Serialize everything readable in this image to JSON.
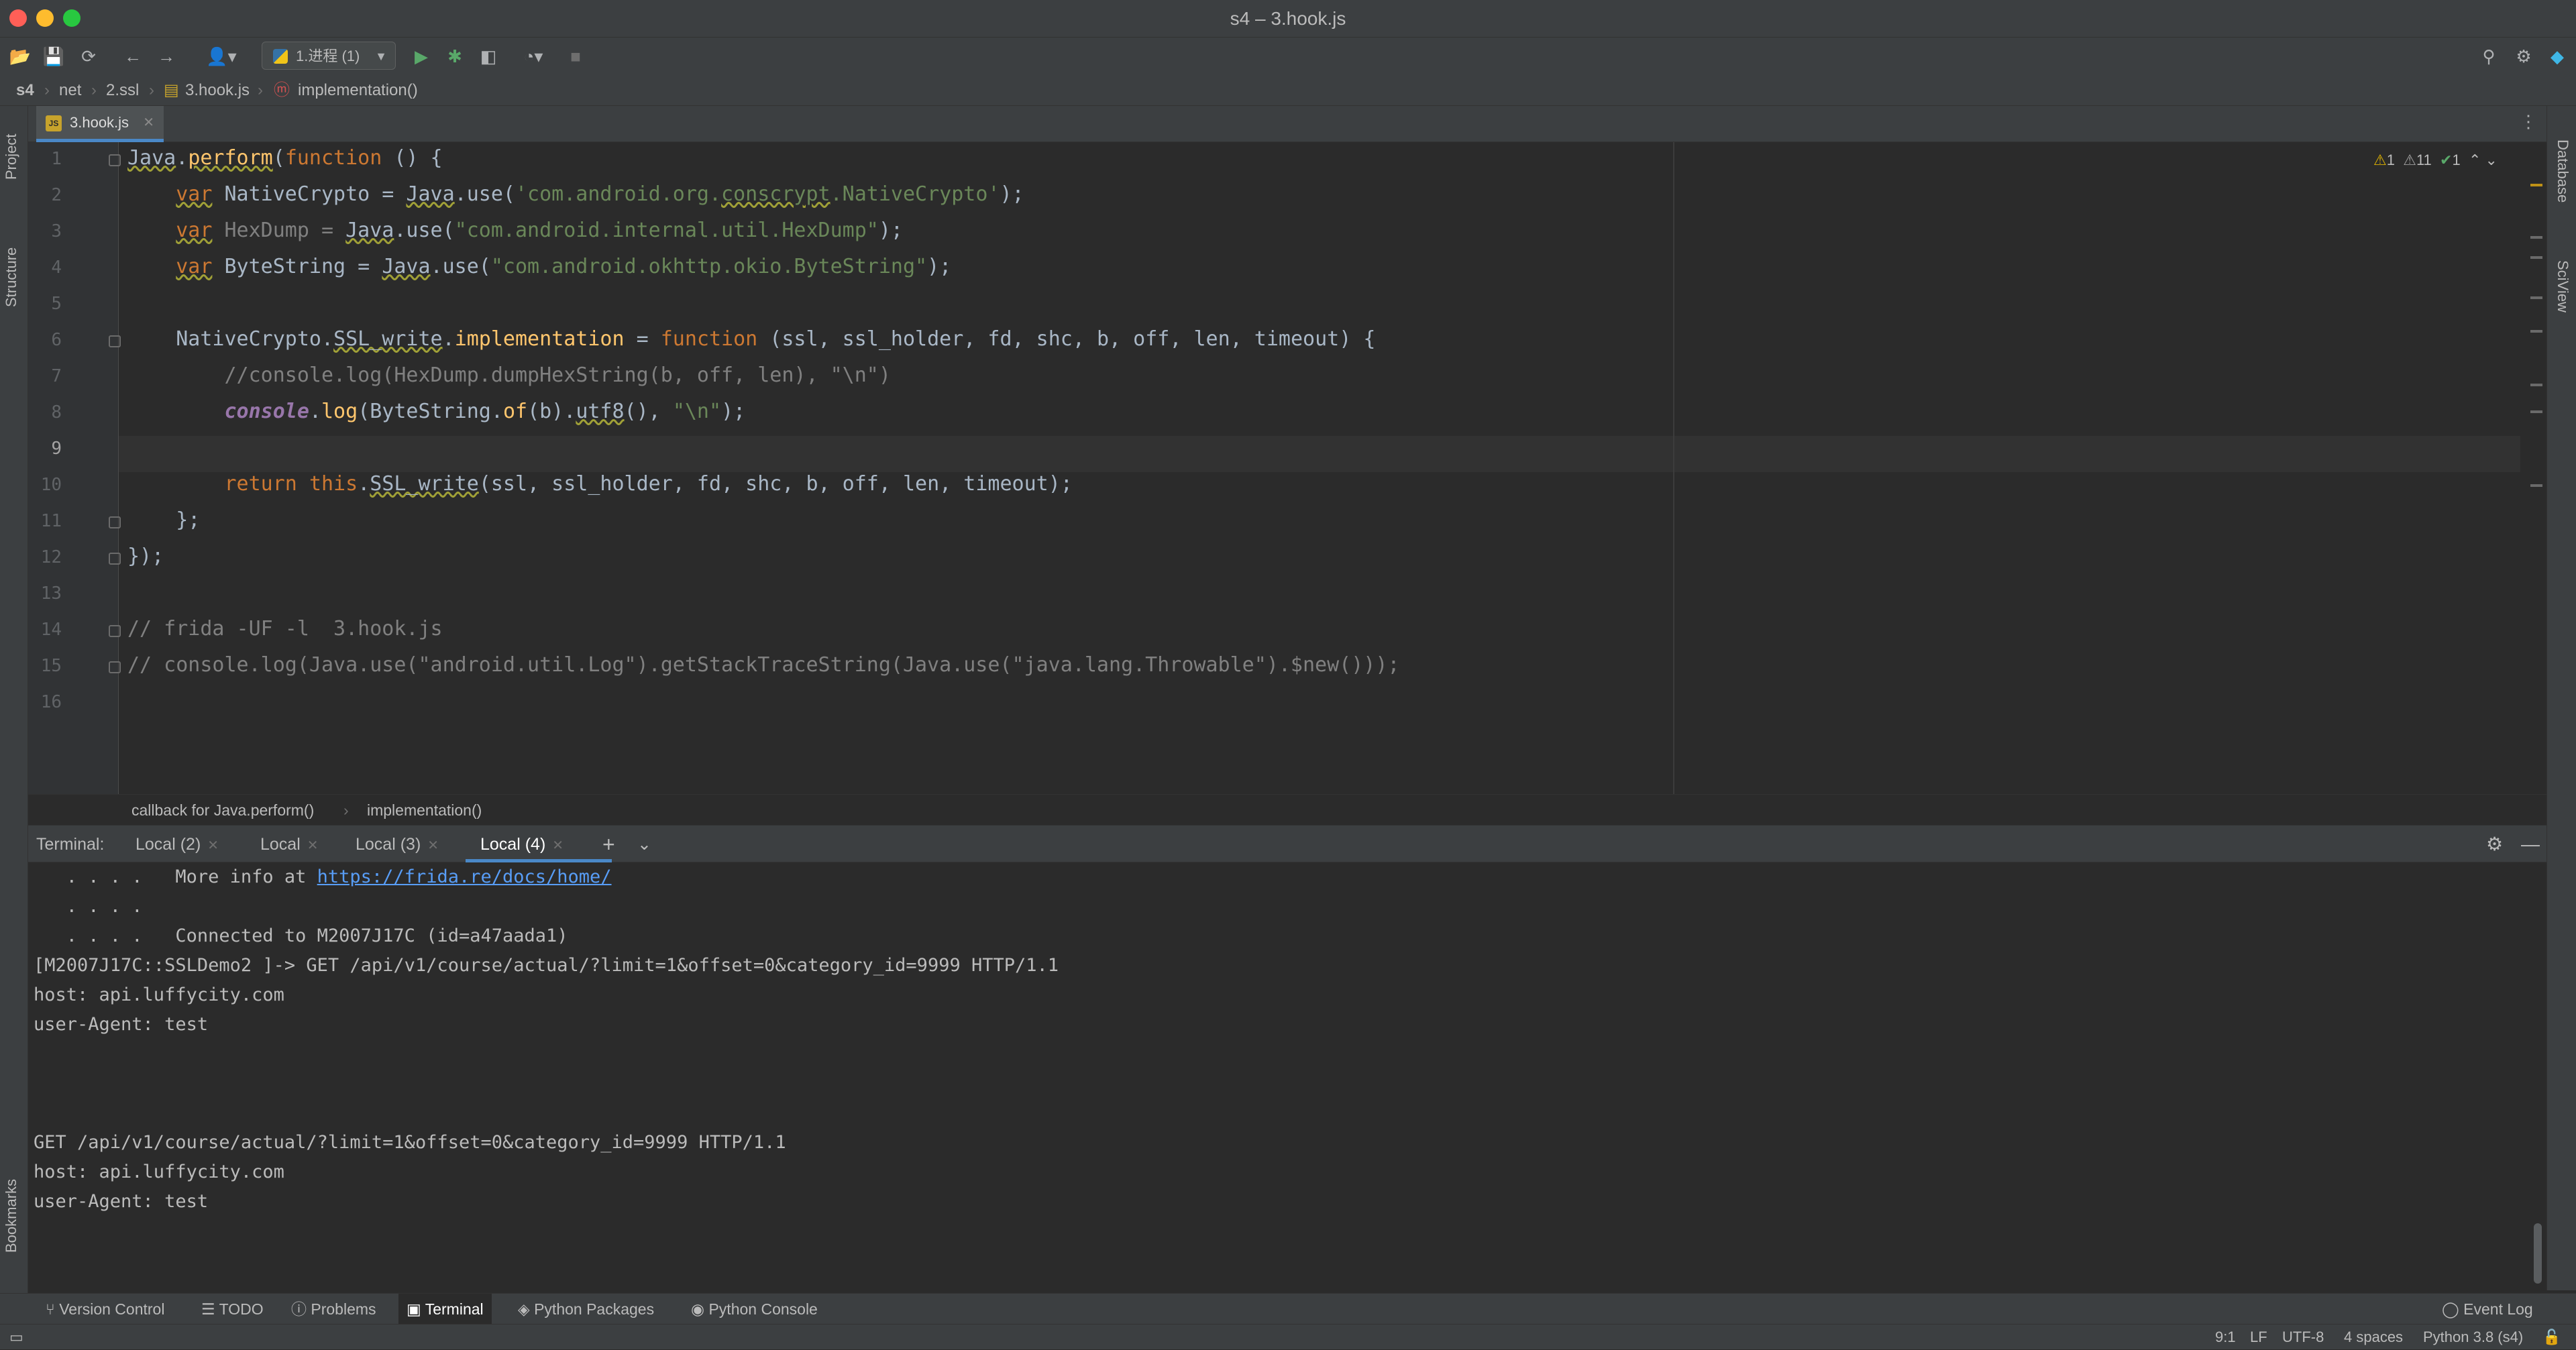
{
  "window": {
    "title": "s4 – 3.hook.js"
  },
  "toolbar": {
    "run_config": "1.进程 (1)",
    "icons": [
      "open-folder-icon",
      "save-icon",
      "sync-icon",
      "back-icon",
      "forward-icon",
      "user-icon",
      "run-icon",
      "debug-icon",
      "coverage-icon",
      "profile-icon",
      "stop-icon",
      "search-icon",
      "settings-icon",
      "jetbrains-icon"
    ]
  },
  "breadcrumb": [
    "s4",
    "net",
    "2.ssl",
    "3.hook.js",
    "implementation()"
  ],
  "left_tools": {
    "project": "Project",
    "structure": "Structure",
    "bookmarks": "Bookmarks"
  },
  "right_tools": {
    "database": "Database",
    "sciview": "SciView"
  },
  "editor": {
    "tab": "3.hook.js",
    "line_numbers": [
      "1",
      "2",
      "3",
      "4",
      "5",
      "6",
      "7",
      "8",
      "9",
      "10",
      "11",
      "12",
      "13",
      "14",
      "15",
      "16"
    ],
    "inspections": {
      "warnings": "1",
      "weak_warnings": "11",
      "ok": "1"
    },
    "lines": {
      "l1_a": "Java",
      "l1_b": ".",
      "l1_c": "perform",
      "l1_d": "(",
      "l1_e": "function",
      "l1_f": " () {",
      "l2_var": "var",
      "l2_name": " NativeCrypto = ",
      "l2_java": "Java",
      "l2_use": ".use(",
      "l2_str_a": "'com.android.org.",
      "l2_str_b": "conscrypt",
      "l2_str_c": ".NativeCrypto'",
      "l2_end": ");",
      "l3_var": "var",
      "l3_name": " HexDump = ",
      "l3_java": "Java",
      "l3_use": ".use(",
      "l3_str": "\"com.android.internal.util.HexDump\"",
      "l3_end": ");",
      "l4_var": "var",
      "l4_name": " ByteString = ",
      "l4_java": "Java",
      "l4_use": ".use(",
      "l4_str": "\"com.android.okhttp.okio.ByteString\"",
      "l4_end": ");",
      "l6_a": "NativeCrypto.",
      "l6_b": "SSL_write",
      "l6_c": ".",
      "l6_d": "implementation",
      "l6_e": " = ",
      "l6_f": "function",
      "l6_g": " (ssl, ssl_holder, fd, shc, b, off, len, timeout) {",
      "l7": "//console.log(HexDump.dumpHexString(b, off, len), \"\\n\")",
      "l8_a": "console",
      "l8_b": ".",
      "l8_c": "log",
      "l8_d": "(ByteString.",
      "l8_e": "of",
      "l8_f": "(b).",
      "l8_g": "utf8",
      "l8_h": "(), ",
      "l8_i": "\"\\n\"",
      "l8_j": ");",
      "l10_a": "return",
      "l10_b": " ",
      "l10_c": "this",
      "l10_d": ".",
      "l10_e": "SSL_write",
      "l10_f": "(ssl, ssl_holder, fd, shc, b, off, len, timeout);",
      "l11": "};",
      "l12": "});",
      "l14": "// frida -UF -l  3.hook.js",
      "l15": "// console.log(Java.use(\"android.util.Log\").getStackTraceString(Java.use(\"java.lang.Throwable\").$new()));"
    }
  },
  "code_crumbs": [
    "callback for Java.perform()",
    "implementation()"
  ],
  "terminal": {
    "label": "Terminal:",
    "tabs": [
      "Local (2)",
      "Local",
      "Local (3)",
      "Local (4)"
    ],
    "active_tab": "Local (4)",
    "lines": [
      "   . . . .   More info at ",
      "   . . . .",
      "   . . . .   Connected to M2007J17C (id=a47aada1)",
      "[M2007J17C::SSLDemo2 ]-> GET /api/v1/course/actual/?limit=1&offset=0&category_id=9999 HTTP/1.1",
      "host: api.luffycity.com",
      "user-Agent: test",
      "GET /api/v1/course/actual/?limit=1&offset=0&category_id=9999 HTTP/1.1",
      "host: api.luffycity.com",
      "user-Agent: test"
    ],
    "link": "https://frida.re/docs/home/"
  },
  "bottom_tools": [
    "Version Control",
    "TODO",
    "Problems",
    "Terminal",
    "Python Packages",
    "Python Console",
    "Event Log"
  ],
  "active_bottom_tool": "Terminal",
  "status": {
    "position": "9:1",
    "line_sep": "LF",
    "encoding": "UTF-8",
    "indent": "4 spaces",
    "interpreter": "Python 3.8 (s4)"
  },
  "colors": {
    "accent": "#4a88c7",
    "keyword": "#cc7832",
    "string": "#6a8759",
    "comment": "#808080",
    "function": "#ffc66d"
  }
}
